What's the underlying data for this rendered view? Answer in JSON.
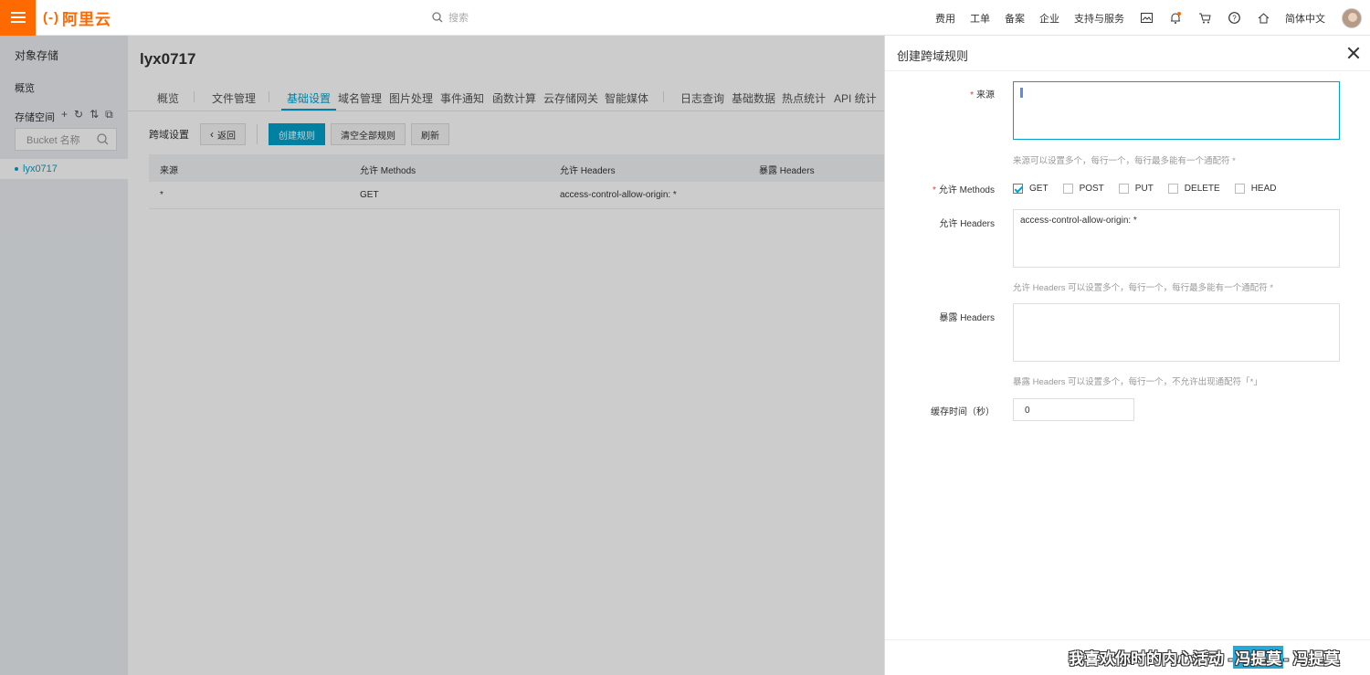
{
  "topbar": {
    "brand": "阿里云",
    "brand_mark": "(-)",
    "search_placeholder": "搜索",
    "nav": [
      "费用",
      "工单",
      "备案",
      "企业",
      "支持与服务"
    ],
    "language": "简体中文"
  },
  "sidebar": {
    "title": "对象存储",
    "overview": "概览",
    "storage_label": "存储空间",
    "bucket_search_placeholder": "Bucket 名称",
    "buckets": [
      "lyx0717"
    ]
  },
  "main": {
    "bucket_name": "lyx0717",
    "tabs": [
      "概览",
      "文件管理",
      "基础设置",
      "域名管理",
      "图片处理",
      "事件通知",
      "函数计算",
      "云存储网关",
      "智能媒体",
      "日志查询",
      "基础数据",
      "热点统计",
      "API 统计"
    ],
    "active_tab": "基础设置",
    "cors_label": "跨域设置",
    "back_button": "返回",
    "create_button": "创建规则",
    "clear_button": "清空全部规则",
    "refresh_button": "刷新",
    "table": {
      "headers": [
        "来源",
        "允许 Methods",
        "允许 Headers",
        "暴露 Headers"
      ],
      "rows": [
        [
          "*",
          "GET",
          "access-control-allow-origin: *",
          ""
        ]
      ]
    }
  },
  "drawer": {
    "title": "创建跨域规则",
    "origin_label": "来源",
    "origin_value": "",
    "origin_hint": "来源可以设置多个，每行一个，每行最多能有一个通配符 *",
    "methods_label": "允许 Methods",
    "methods": [
      {
        "name": "GET",
        "checked": true
      },
      {
        "name": "POST",
        "checked": false
      },
      {
        "name": "PUT",
        "checked": false
      },
      {
        "name": "DELETE",
        "checked": false
      },
      {
        "name": "HEAD",
        "checked": false
      }
    ],
    "allow_headers_label": "允许 Headers",
    "allow_headers_value": "access-control-allow-origin: *",
    "allow_headers_hint": "允许 Headers 可以设置多个，每行一个，每行最多能有一个通配符 *",
    "expose_headers_label": "暴露 Headers",
    "expose_headers_value": "",
    "expose_headers_hint": "暴露 Headers 可以设置多个，每行一个，不允许出现通配符「*」",
    "cache_label": "缓存时间（秒）",
    "cache_value": "0"
  },
  "subtitle": {
    "text": "我喜欢你时的内心活动 - ",
    "highlight": "冯提莫",
    "suffix": " - 冯提莫"
  },
  "colors": {
    "brand": "#ff6a00",
    "accent": "#00a2ca",
    "required": "#e4393c"
  }
}
